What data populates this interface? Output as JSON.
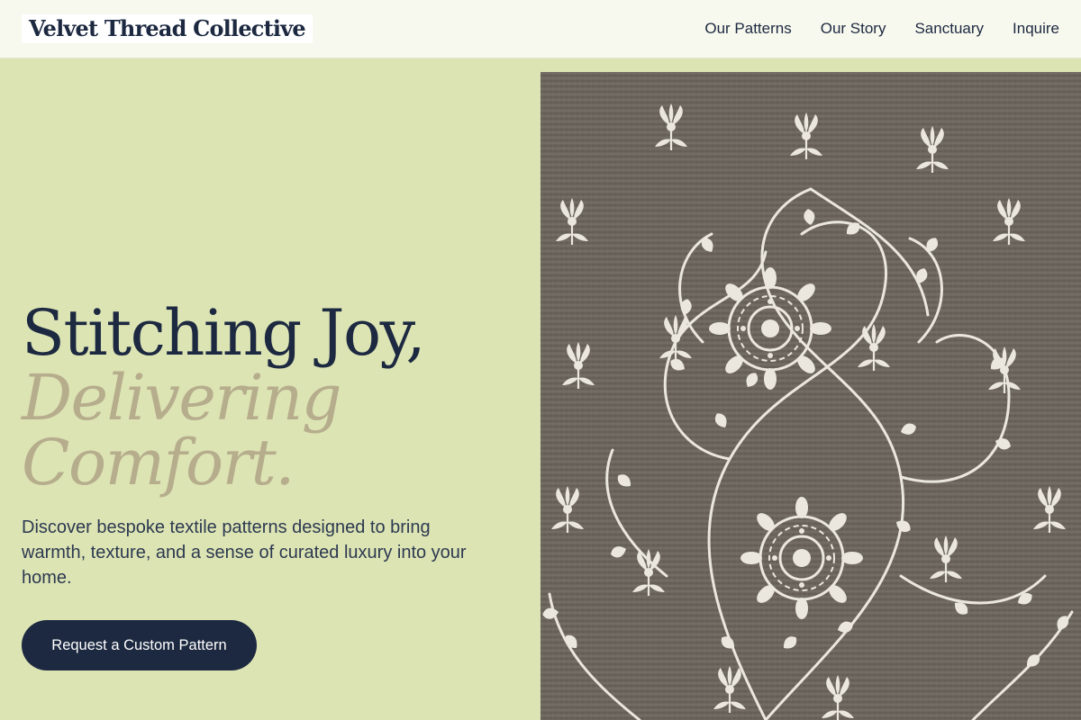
{
  "header": {
    "logo": "Velvet Thread Collective",
    "nav": [
      "Our Patterns",
      "Our Story",
      "Sanctuary",
      "Inquire"
    ]
  },
  "hero": {
    "title_line1": "Stitching Joy,",
    "title_line2": "Delivering",
    "title_line3": "Comfort.",
    "description": "Discover bespoke textile patterns designed to bring warmth, texture, and a sense of curated luxury into your home.",
    "cta_label": "Request a Custom Pattern",
    "image": "embroidered-textile-image"
  },
  "colors": {
    "page_background": "#dde4b4",
    "header_background": "#f7f8ee",
    "navy": "#1c2940",
    "accent_taupe": "#b6ad8d",
    "fabric": "#6b655d"
  }
}
